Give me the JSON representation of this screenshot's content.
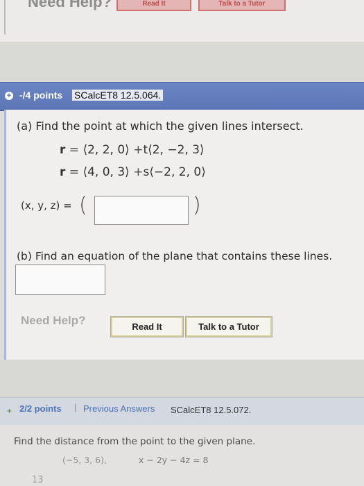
{
  "top": {
    "need_help": "Need Help?",
    "read_it": "Read It",
    "talk_tutor": "Talk to a Tutor"
  },
  "question": {
    "points": "-/4 points",
    "code": "SCalcET8 12.5.064.",
    "part_a": "(a) Find the point at which the given lines intersect.",
    "line1": {
      "var": "r",
      "op1": "=",
      "point": "⟨2, 2, 0⟩",
      "op2": "+",
      "param": "t",
      "dir": "⟨2, −2, 3⟩"
    },
    "line2": {
      "var": "r",
      "op1": "=",
      "point": "⟨4, 0, 3⟩",
      "op2": "+",
      "param": "s",
      "dir": "⟨−2, 2, 0⟩"
    },
    "xyz_label": "(x, y, z) =",
    "lparen": "(",
    "rparen": ")",
    "answer_a": "",
    "part_b": "(b) Find an equation of the plane that contains these lines.",
    "answer_b": "",
    "need_help": "Need Help?",
    "read_it": "Read It",
    "talk_tutor": "Talk to a Tutor"
  },
  "next_question": {
    "points": "2/2 points",
    "separator": "|",
    "previous_answers": "Previous Answers",
    "code": "SCalcET8 12.5.072.",
    "prompt": "Find the distance from the point to the given plane.",
    "point": "(−5, 3, 6),",
    "plane": "x − 2y − 4z = 8",
    "answer": "13"
  },
  "colors": {
    "header_bar": "#5c75b6",
    "header_text": "#ffffff",
    "link_blue": "#4c74b8",
    "check_green": "#6fa03c",
    "help_gray": "#a9a9a9"
  }
}
